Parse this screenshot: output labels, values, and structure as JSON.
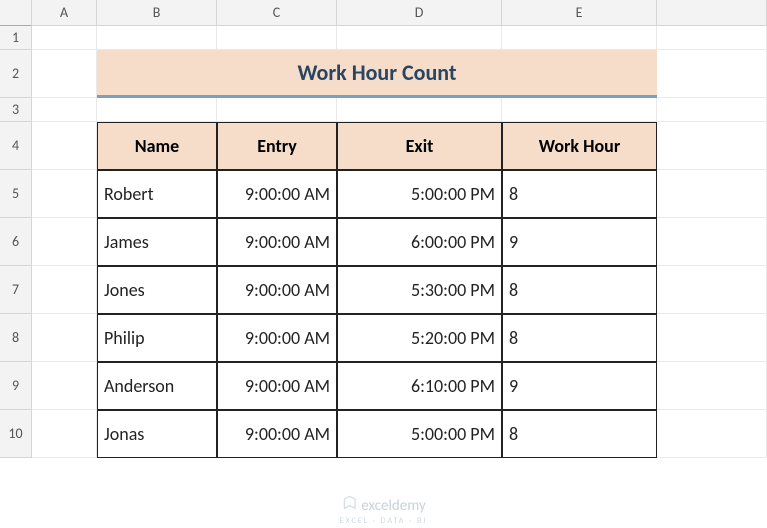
{
  "columns": [
    "A",
    "B",
    "C",
    "D",
    "E"
  ],
  "row_numbers": [
    "1",
    "2",
    "3",
    "4",
    "5",
    "6",
    "7",
    "8",
    "9",
    "10"
  ],
  "title": "Work Hour Count",
  "headers": {
    "name": "Name",
    "entry": "Entry",
    "exit": "Exit",
    "work_hour": "Work Hour"
  },
  "rows": [
    {
      "name": "Robert",
      "entry": "9:00:00 AM",
      "exit": "5:00:00 PM",
      "work_hour": "8"
    },
    {
      "name": "James",
      "entry": "9:00:00 AM",
      "exit": "6:00:00 PM",
      "work_hour": "9"
    },
    {
      "name": "Jones",
      "entry": "9:00:00 AM",
      "exit": "5:30:00 PM",
      "work_hour": "8"
    },
    {
      "name": "Philip",
      "entry": "9:00:00 AM",
      "exit": "5:20:00 PM",
      "work_hour": "8"
    },
    {
      "name": "Anderson",
      "entry": "9:00:00 AM",
      "exit": "6:10:00 PM",
      "work_hour": "9"
    },
    {
      "name": "Jonas",
      "entry": "9:00:00 AM",
      "exit": "5:00:00 PM",
      "work_hour": "8"
    }
  ],
  "watermark": {
    "brand": "exceldemy",
    "sub": "EXCEL · DATA · BI"
  },
  "chart_data": {
    "type": "table",
    "title": "Work Hour Count",
    "columns": [
      "Name",
      "Entry",
      "Exit",
      "Work Hour"
    ],
    "data": [
      [
        "Robert",
        "9:00:00 AM",
        "5:00:00 PM",
        8
      ],
      [
        "James",
        "9:00:00 AM",
        "6:00:00 PM",
        9
      ],
      [
        "Jones",
        "9:00:00 AM",
        "5:30:00 PM",
        8
      ],
      [
        "Philip",
        "9:00:00 AM",
        "5:20:00 PM",
        8
      ],
      [
        "Anderson",
        "9:00:00 AM",
        "6:10:00 PM",
        9
      ],
      [
        "Jonas",
        "9:00:00 AM",
        "5:00:00 PM",
        8
      ]
    ]
  }
}
